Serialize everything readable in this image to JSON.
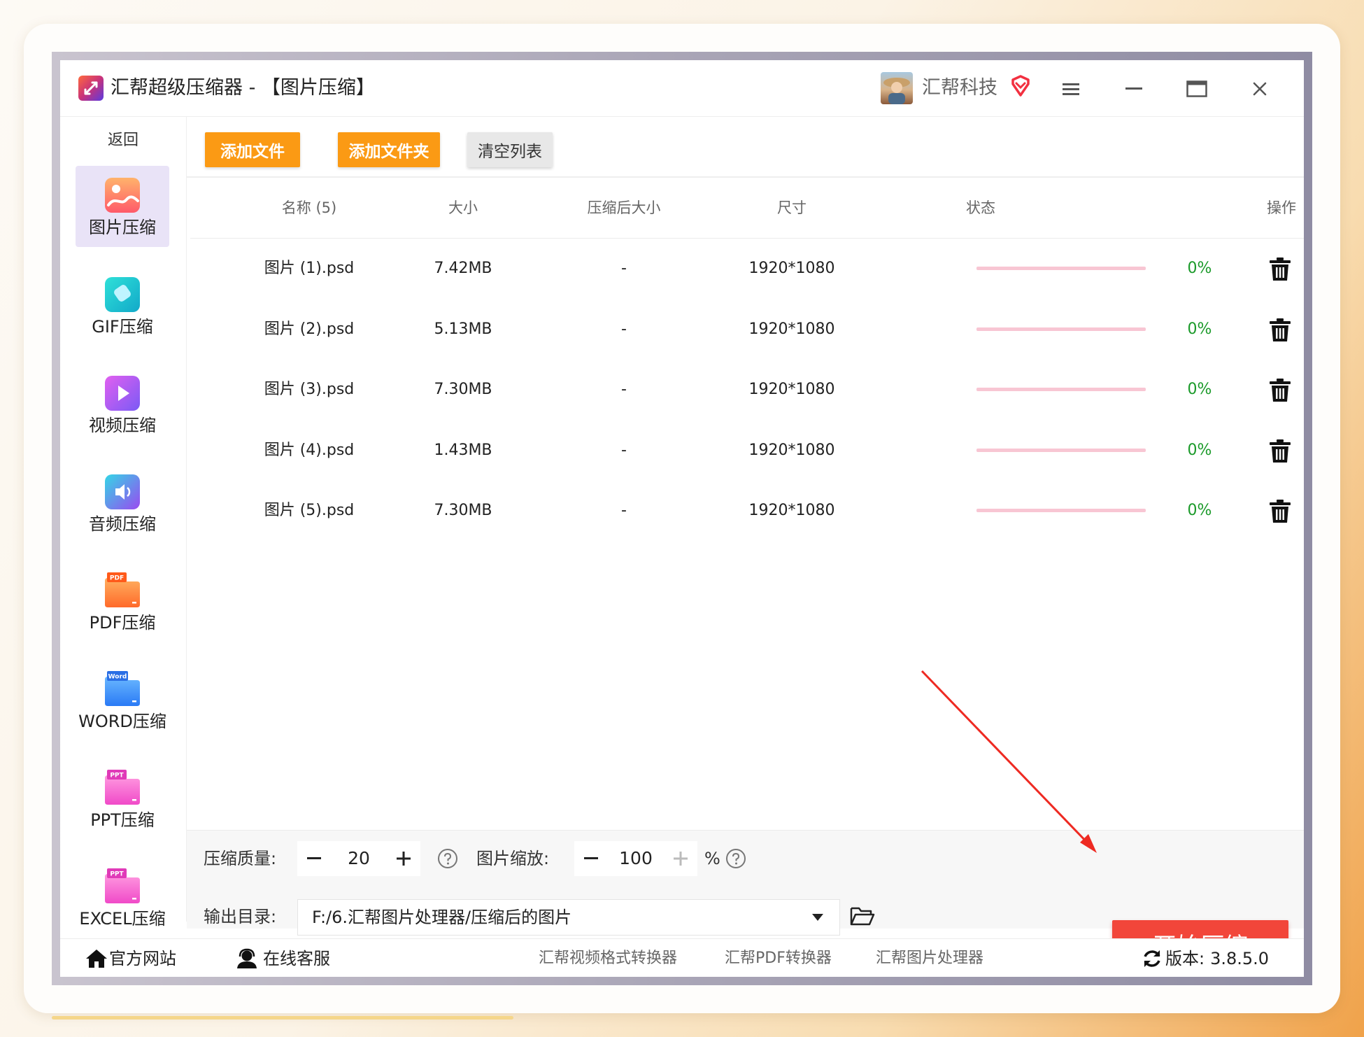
{
  "window": {
    "title": "汇帮超级压缩器  - 【图片压缩】",
    "user_name": "汇帮科技"
  },
  "sidebar": {
    "back_label": "返回",
    "items": [
      {
        "label": "图片压缩",
        "icon": "image-icon",
        "active": true
      },
      {
        "label": "GIF压缩",
        "icon": "gif-icon",
        "active": false
      },
      {
        "label": "视频压缩",
        "icon": "video-icon",
        "active": false
      },
      {
        "label": "音频压缩",
        "icon": "audio-icon",
        "active": false
      },
      {
        "label": "PDF压缩",
        "icon": "pdf-folder-icon",
        "badge": "PDF",
        "active": false
      },
      {
        "label": "WORD压缩",
        "icon": "word-folder-icon",
        "badge": "Word",
        "active": false
      },
      {
        "label": "PPT压缩",
        "icon": "ppt-folder-icon",
        "badge": "PPT",
        "active": false
      },
      {
        "label": "EXCEL压缩",
        "icon": "excel-folder-icon",
        "badge": "PPT",
        "active": false
      }
    ]
  },
  "toolbar": {
    "add_file": "添加文件",
    "add_folder": "添加文件夹",
    "clear_list": "清空列表"
  },
  "table": {
    "headers": {
      "name": "名称 (5)",
      "size": "大小",
      "compressed_size": "压缩后大小",
      "dimensions": "尺寸",
      "status": "状态",
      "action": "操作"
    },
    "rows": [
      {
        "name": "图片 (1).psd",
        "size": "7.42MB",
        "compressed_size": "-",
        "dimensions": "1920*1080",
        "progress": 0,
        "progress_text": "0%"
      },
      {
        "name": "图片 (2).psd",
        "size": "5.13MB",
        "compressed_size": "-",
        "dimensions": "1920*1080",
        "progress": 0,
        "progress_text": "0%"
      },
      {
        "name": "图片 (3).psd",
        "size": "7.30MB",
        "compressed_size": "-",
        "dimensions": "1920*1080",
        "progress": 0,
        "progress_text": "0%"
      },
      {
        "name": "图片 (4).psd",
        "size": "1.43MB",
        "compressed_size": "-",
        "dimensions": "1920*1080",
        "progress": 0,
        "progress_text": "0%"
      },
      {
        "name": "图片 (5).psd",
        "size": "7.30MB",
        "compressed_size": "-",
        "dimensions": "1920*1080",
        "progress": 0,
        "progress_text": "0%"
      }
    ]
  },
  "settings": {
    "quality_label": "压缩质量:",
    "quality_value": "20",
    "scale_label": "图片缩放:",
    "scale_value": "100",
    "scale_unit": "%",
    "output_label": "输出目录:",
    "output_path": "F:/6.汇帮图片处理器/压缩后的图片",
    "start_button": "开始压缩"
  },
  "footer": {
    "website": "官方网站",
    "support": "在线客服",
    "links": [
      "汇帮视频格式转换器",
      "汇帮PDF转换器",
      "汇帮图片处理器"
    ],
    "version_label": "版本:",
    "version_value": "3.8.5.0"
  },
  "colors": {
    "accent_orange": "#fb9a14",
    "start_red": "#f2463a",
    "progress_green": "#1b9a2a",
    "progress_track": "#f8c6d3",
    "active_side": "#e9e3f7"
  }
}
